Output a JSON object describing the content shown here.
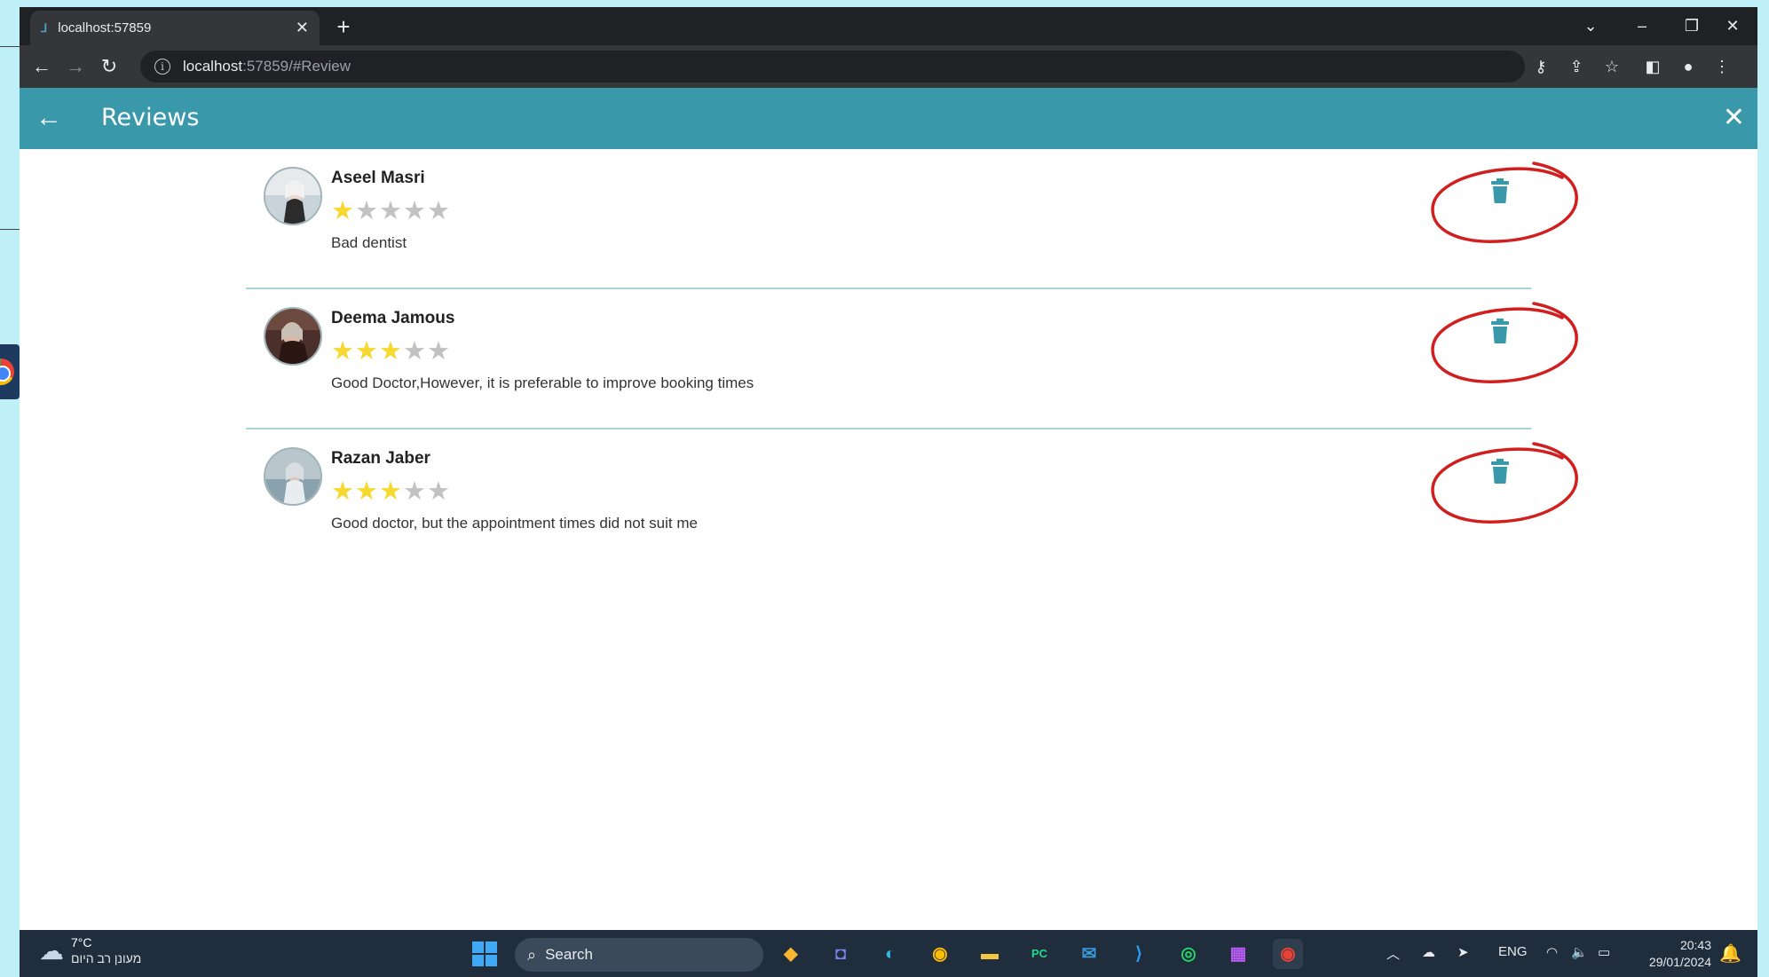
{
  "browser": {
    "tab_title": "localhost:57859",
    "url_host": "localhost",
    "url_rest": ":57859/#Review"
  },
  "app": {
    "title": "Reviews"
  },
  "reviews": [
    {
      "name": "Aseel Masri",
      "rating": 1,
      "max_rating": 5,
      "text": "Bad dentist"
    },
    {
      "name": "Deema Jamous",
      "rating": 3,
      "max_rating": 5,
      "text": "Good Doctor,However, it is preferable to improve booking times"
    },
    {
      "name": "Razan Jaber",
      "rating": 3,
      "max_rating": 5,
      "text": "Good doctor, but the appointment times did not suit me"
    }
  ],
  "taskbar": {
    "weather_temp": "7°C",
    "weather_desc": "מעונן רב היום",
    "search_label": "Search",
    "language": "ENG",
    "time": "20:43",
    "date": "29/01/2024"
  },
  "colors": {
    "accent": "#3a98ab",
    "star_on": "#f6d82e",
    "star_off": "#c2c2c2",
    "annotation": "#d11f1f"
  }
}
